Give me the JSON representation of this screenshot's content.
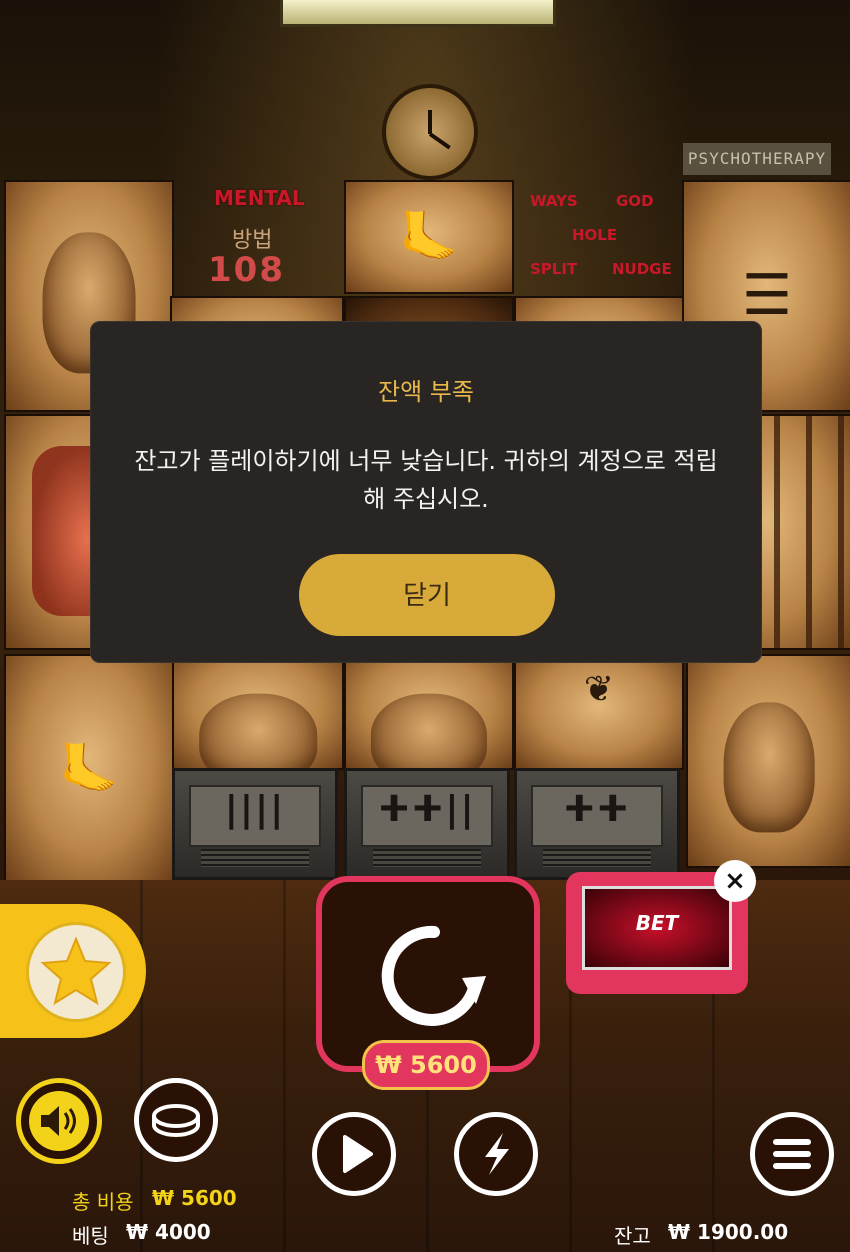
{
  "background": {
    "psychotherapy_sign": "PSYCHOTHERAPY",
    "mental_sign": "MENTAL",
    "method_label": "방법",
    "method_counter": "108",
    "feature_signs": [
      "WAYS",
      "GOD",
      "HOLE",
      "SPLIT",
      "NUDGE"
    ]
  },
  "dialog": {
    "title": "잔액 부족",
    "message": "잔고가 플레이하기에 너무 낮습니다. 귀하의 계정으로 적립해 주십시오.",
    "close_label": "닫기"
  },
  "controls": {
    "spin_price": "₩ 5600",
    "xbet_label": "BET",
    "xbet_close": "×"
  },
  "footer": {
    "total_cost_label": "총 비용",
    "total_cost_value": "₩ 5600",
    "bet_label": "베팅",
    "bet_value": "₩ 4000",
    "balance_label": "잔고",
    "balance_value": "₩ 1900.00"
  },
  "colors": {
    "accent_gold": "#d8aa3a",
    "accent_pink": "#e2365e",
    "accent_yellow": "#f3d21a",
    "dialog_bg": "#292522"
  }
}
